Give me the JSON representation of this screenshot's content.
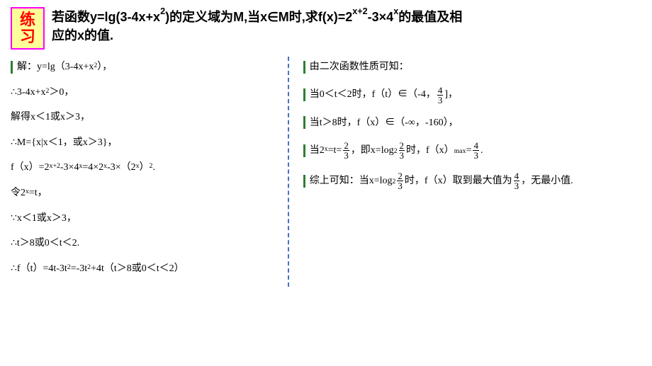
{
  "badge": {
    "line1": "练",
    "line2": "习"
  },
  "problem": {
    "line1_pre": "若函数y=lg(3-4x+x",
    "line1_sup": "2",
    "line1_mid": ")的定义域为M,当x∈M时,求f(x)=2",
    "line1_sup2": "x+2",
    "line1_mid2": "-3×4",
    "line1_sup3": "x",
    "line1_post": "的最值及相",
    "line2": "应的x的值."
  },
  "left": {
    "l1_pre": "解：y=lg（3-4x+x",
    "l1_sup": "2",
    "l1_post": "），",
    "l2_pre": "∴3-4x+x",
    "l2_sup": "2",
    "l2_post": "＞0，",
    "l3": "解得x＜1或x＞3，",
    "l4": "∴M={x|x＜1，或x＞3}，",
    "l5_pre": "f（x）=2",
    "l5_s1": "x+2",
    "l5_m1": "-3×4",
    "l5_s2": "x",
    "l5_m2": "=4×2",
    "l5_s3": "x",
    "l5_m3": "-3×（2",
    "l5_s4": "x",
    "l5_m4": "）",
    "l5_s5": "2",
    "l5_post": ".",
    "l6_pre": "令2",
    "l6_sup": "x",
    "l6_post": "=t，",
    "l7": "∵x＜1或x＞3，",
    "l8": "∴t＞8或0＜t＜2.",
    "l9_pre": "∴f（t）=4t-3t",
    "l9_s1": "2",
    "l9_m": "=-3t",
    "l9_s2": "2",
    "l9_post": "+4t（t＞8或0＜t＜2）"
  },
  "right": {
    "r1": "由二次函数性质可知：",
    "r2_pre": "当0＜t＜2时，f（t）∈（-4，",
    "r2_num": "4",
    "r2_den": "3",
    "r2_post": "]，",
    "r3": "当t＞8时，f（x）∈（-∞，-160），",
    "r4_pre": "当2",
    "r4_sup": "x",
    "r4_m1": "=t=",
    "r4_n1": "2",
    "r4_d1": "3",
    "r4_m2": "，即x=log",
    "r4_sub": "2",
    "r4_n2": "2",
    "r4_d2": "3",
    "r4_m3": "时，f（x）",
    "r4_max": "max",
    "r4_m4": "=",
    "r4_n3": "4",
    "r4_d3": "3",
    "r4_post": ".",
    "r5_pre": "综上可知：当x=log",
    "r5_sub": "2",
    "r5_n1": "2",
    "r5_d1": "3",
    "r5_m1": "时，f（x）取到最大值为",
    "r5_n2": "4",
    "r5_d2": "3",
    "r5_post": "，无最小值."
  }
}
